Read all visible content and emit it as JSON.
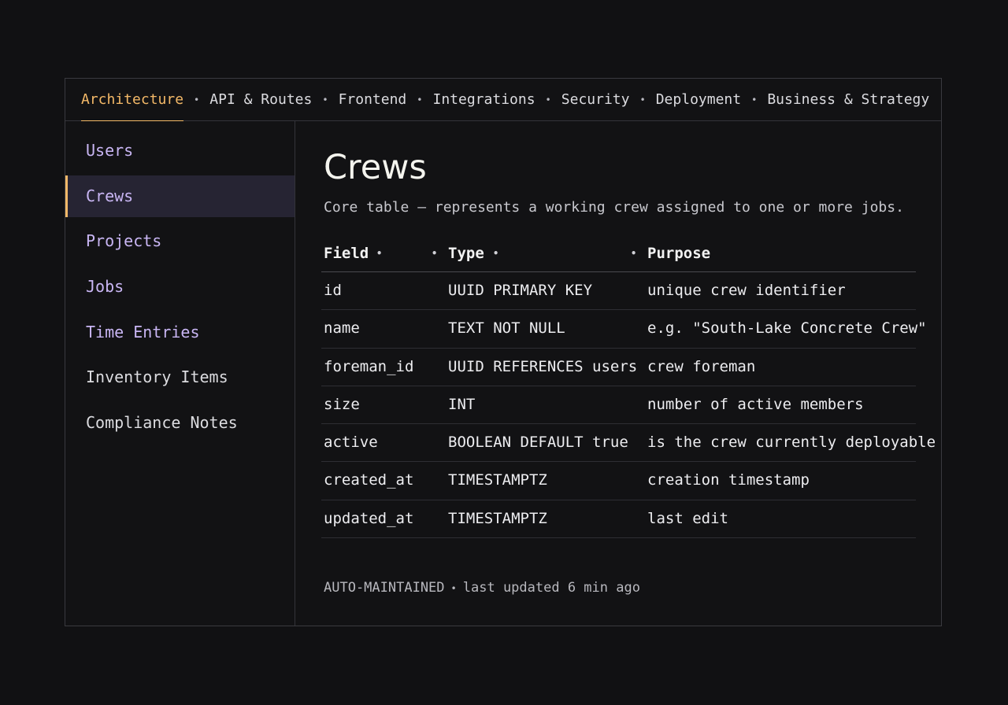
{
  "tabs": [
    {
      "label": "Architecture",
      "active": true
    },
    {
      "label": "API & Routes",
      "active": false
    },
    {
      "label": "Frontend",
      "active": false
    },
    {
      "label": "Integrations",
      "active": false
    },
    {
      "label": "Security",
      "active": false
    },
    {
      "label": "Deployment",
      "active": false
    },
    {
      "label": "Business & Strategy",
      "active": false
    }
  ],
  "tab_separator": "•",
  "sidebar": {
    "items": [
      {
        "label": "Users"
      },
      {
        "label": "Crews"
      },
      {
        "label": "Projects"
      },
      {
        "label": "Jobs"
      },
      {
        "label": "Time Entries"
      },
      {
        "label": "Inventory Items"
      },
      {
        "label": "Compliance Notes"
      }
    ]
  },
  "main": {
    "title": "Crews",
    "description": "Core table — represents a working crew assigned to one or more jobs.",
    "table": {
      "headers": [
        "Field",
        "Type",
        "Purpose"
      ],
      "header_dot": "•",
      "rows": [
        [
          "id",
          "UUID PRIMARY KEY",
          "unique crew identifier"
        ],
        [
          "name",
          "TEXT NOT NULL",
          "e.g. \"South-Lake Concrete Crew\""
        ],
        [
          "foreman_id",
          "UUID REFERENCES users",
          "crew foreman"
        ],
        [
          "size",
          "INT",
          "number of active members"
        ],
        [
          "active",
          "BOOLEAN DEFAULT true",
          "is the crew currently deployable"
        ],
        [
          "created_at",
          "TIMESTAMPTZ",
          "creation timestamp"
        ],
        [
          "updated_at",
          "TIMESTAMPTZ",
          "last edit"
        ]
      ]
    },
    "footer": {
      "badge": "AUTO-MAINTAINED",
      "separator": "•",
      "updated": "last updated 6 min ago"
    }
  },
  "colors": {
    "accent": "#f4b968",
    "link": "#c9b6f4",
    "background": "#111113"
  }
}
